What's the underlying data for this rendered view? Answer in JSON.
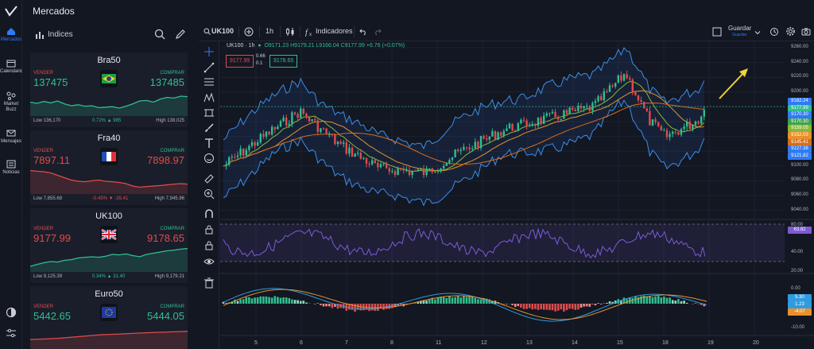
{
  "app": {
    "title": "Mercados"
  },
  "rail": {
    "items": [
      {
        "label": "Mercados"
      },
      {
        "label": "Calendario"
      },
      {
        "label": "Market Buzz"
      },
      {
        "label": "Mensajes"
      },
      {
        "label": "Noticias"
      }
    ]
  },
  "panel": {
    "title": "Indices",
    "cards": [
      {
        "name": "Bra50",
        "sell_label": "VENDER",
        "buy_label": "COMPRAR",
        "sell": "137475",
        "buy": "137485",
        "low": "Low 136,170",
        "change": "0.72% ▲ 985",
        "high": "High 138,025",
        "trend": "up",
        "spark": [
          0.55,
          0.6,
          0.52,
          0.58,
          0.5,
          0.62,
          0.7,
          0.66,
          0.72,
          0.7,
          0.78,
          0.76,
          0.74,
          0.8,
          0.72,
          0.62,
          0.5,
          0.48,
          0.55,
          0.42,
          0.35,
          0.38,
          0.3,
          0.32
        ]
      },
      {
        "name": "Fra40",
        "sell_label": "VENDER",
        "buy_label": "COMPRAR",
        "sell": "7897.11",
        "buy": "7898.97",
        "low": "Low 7,855.68",
        "change": "-0.45% ▼ -35.41",
        "high": "High 7,945.96",
        "trend": "down",
        "spark": [
          0.15,
          0.18,
          0.2,
          0.25,
          0.35,
          0.45,
          0.55,
          0.6,
          0.62,
          0.58,
          0.55,
          0.6,
          0.62,
          0.65,
          0.7,
          0.8,
          0.85,
          0.82,
          0.8,
          0.78,
          0.75,
          0.72,
          0.7,
          0.72
        ]
      },
      {
        "name": "UK100",
        "sell_label": "VENDER",
        "buy_label": "COMPRAR",
        "sell": "9177.99",
        "buy": "9178.65",
        "low": "Low 9,125.39",
        "change": "0.34% ▲ 31.40",
        "high": "High 9,179.21",
        "trend": "up",
        "spark": [
          0.9,
          0.82,
          0.75,
          0.7,
          0.72,
          0.65,
          0.62,
          0.55,
          0.52,
          0.5,
          0.52,
          0.48,
          0.4,
          0.42,
          0.38,
          0.45,
          0.5,
          0.4,
          0.35,
          0.3,
          0.25,
          0.22,
          0.18,
          0.15
        ]
      },
      {
        "name": "Euro50",
        "sell_label": "VENDER",
        "buy_label": "COMPRAR",
        "sell": "5442.65",
        "buy": "5444.05",
        "low": "",
        "change": "",
        "high": "",
        "trend": "down",
        "spark": [
          0.7,
          0.68,
          0.65,
          0.6,
          0.55,
          0.5,
          0.48,
          0.45,
          0.42,
          0.4,
          0.38,
          0.36
        ]
      }
    ]
  },
  "toolbar": {
    "symbol": "UK100",
    "interval": "1h",
    "indicators_label": "Indicadores",
    "save_label": "Guardar",
    "save_sub": "Guardar"
  },
  "chart": {
    "legend_title": "UK100 · 1h",
    "ohlc": "O9171.23 H9179.21 L9166.04 C9177.99 +6.76 (+0.07%)",
    "bid": "9177.99",
    "ask": "9178.65",
    "spread_a": "0.66",
    "spread_b": "0.1",
    "y_ticks": [
      "9260.00",
      "9240.00",
      "9220.00",
      "9200.00",
      "9180.00",
      "9160.00",
      "9140.00",
      "9120.00",
      "9100.00",
      "9080.00",
      "9060.00",
      "9040.00"
    ],
    "price_tags": [
      {
        "value": "9182.24",
        "color": "#2f7bf5"
      },
      {
        "value": "9177.99",
        "color": "#2fbf8f"
      },
      {
        "value": "9170.30",
        "color": "#2f7bf5"
      },
      {
        "value": "9170.30",
        "color": "#3fa34d"
      },
      {
        "value": "9159.05",
        "color": "#8ab832"
      },
      {
        "value": "9152.03",
        "color": "#e8912c"
      },
      {
        "value": "9145.41",
        "color": "#d96c1a"
      },
      {
        "value": "9127.38",
        "color": "#2f7bf5"
      },
      {
        "value": "9121.82",
        "color": "#2f7bf5"
      }
    ],
    "rsi_tag": "63.82",
    "rsi_levels": [
      "80.00",
      "40.00",
      "20.00"
    ],
    "macd_tags": [
      {
        "value": "5.30",
        "color": "#2f9be0"
      },
      {
        "value": "1.23",
        "color": "#2f9be0"
      },
      {
        "value": "-4.07",
        "color": "#e8912c"
      }
    ],
    "macd_levels": [
      "0.00",
      "-10.00"
    ],
    "x_ticks": [
      "5",
      "6",
      "7",
      "8",
      "11",
      "12",
      "13",
      "14",
      "15",
      "18",
      "19",
      "20"
    ]
  }
}
